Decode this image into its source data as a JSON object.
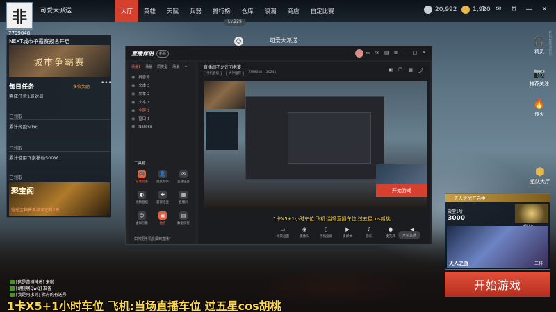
{
  "topbar": {
    "player_name": "可爱大派送",
    "level": "Lv.229",
    "room_id": "7799048",
    "tabs": [
      "大厅",
      "英雄",
      "天赋",
      "兵器",
      "排行榜",
      "仓库",
      "浪潮",
      "商店",
      "自定比赛"
    ],
    "active_tab": "大厅",
    "coins_silver": "20,992",
    "coins_gold": "1,920",
    "logo_glyph": "非",
    "icons": [
      "help-icon",
      "mail-icon",
      "settings-icon",
      "minimize-icon",
      "close-icon"
    ]
  },
  "center": {
    "subtitle": "可爱大派送"
  },
  "left_panel": {
    "event_title": "NEXT城市争霸赛报名开启",
    "event_banner": "城市争霸赛",
    "tasks_title": "每日任务",
    "tasks_more": "多倍奖励",
    "tasks": [
      {
        "name": "完成任意1局对局",
        "status": "已领取"
      },
      {
        "name": "累计奔跑50米",
        "status": "已领取"
      },
      {
        "name": "累计使用飞索移动500米",
        "status": "已领取"
      }
    ],
    "treasure_title": "聚宝阁",
    "treasure_note": "逍遥宝箱售卖结束还有2天"
  },
  "stream_window": {
    "logo": "直播伴侣",
    "logo_badge": "新版",
    "scene_tabs": [
      "场景1",
      "场景",
      "同类型",
      "场景"
    ],
    "sources": [
      "抖音号",
      "文本 3",
      "文本 2",
      "文本 1",
      "全屏 1",
      "窗口 1",
      "Naraka"
    ],
    "tools_title": "工具箱",
    "tools": [
      {
        "label": "游戏助手",
        "glyph": "🎮",
        "hot": true
      },
      {
        "label": "观赏助手",
        "glyph": "👤",
        "hot": false
      },
      {
        "label": "主播任务",
        "glyph": "✉",
        "hot": false
      },
      {
        "label": "视频直播",
        "glyph": "◐",
        "hot": false
      },
      {
        "label": "嘉宾连麦",
        "glyph": "✚",
        "hot": false
      },
      {
        "label": "直播间",
        "glyph": "▦",
        "hot": false
      },
      {
        "label": "虚拟形象",
        "glyph": "☺",
        "hot": false
      },
      {
        "label": "抽奖",
        "glyph": "▣",
        "hot": true
      },
      {
        "label": "数据排行",
        "glyph": "▤",
        "hot": false
      }
    ],
    "feedback": "如何把手机投屏到直播？",
    "stream_title": "直播间不允许问老婆",
    "stream_meta": [
      "手机直播",
      "大神推荐",
      "7799048",
      "20245"
    ],
    "caption": "1卡X5+1小时车位 飞机:当场直播车位 过五星cos胡桃",
    "bottom_tools": [
      "场景画面",
      "摄像头",
      "手机投屏",
      "多媒体",
      "音乐",
      "麦克风",
      "扬声器"
    ],
    "live_button": "开始直播",
    "nested_start": "开始游戏"
  },
  "right_panel": {
    "icons": [
      {
        "label": "精灵",
        "glyph": "🎧"
      },
      {
        "label": "推荐关注",
        "glyph": "📷"
      },
      {
        "label": "传火",
        "glyph": "🔥"
      }
    ],
    "team_hall": "组队大厅",
    "mode_header": "天人之战开启中",
    "rank_label": "殿堂1阶",
    "rank_value": "3000",
    "team_label": "三排",
    "mode_name": "天人之战",
    "mode_extra": "组队友",
    "start_button": "开始游戏"
  },
  "chat": [
    {
      "name": "[这是苦捕神着]",
      "text": "来啦"
    },
    {
      "name": "[胡桃啊QwQ]",
      "text": "准备"
    },
    {
      "name": "[我是阿求兑]",
      "text": "佛舟的有送号"
    }
  ],
  "overlay_caption": "1卡X5+1小时车位 飞机:当场直播车位 过五星cos胡桃",
  "side_watermark": "NL.LT.190.PPOLICE"
}
